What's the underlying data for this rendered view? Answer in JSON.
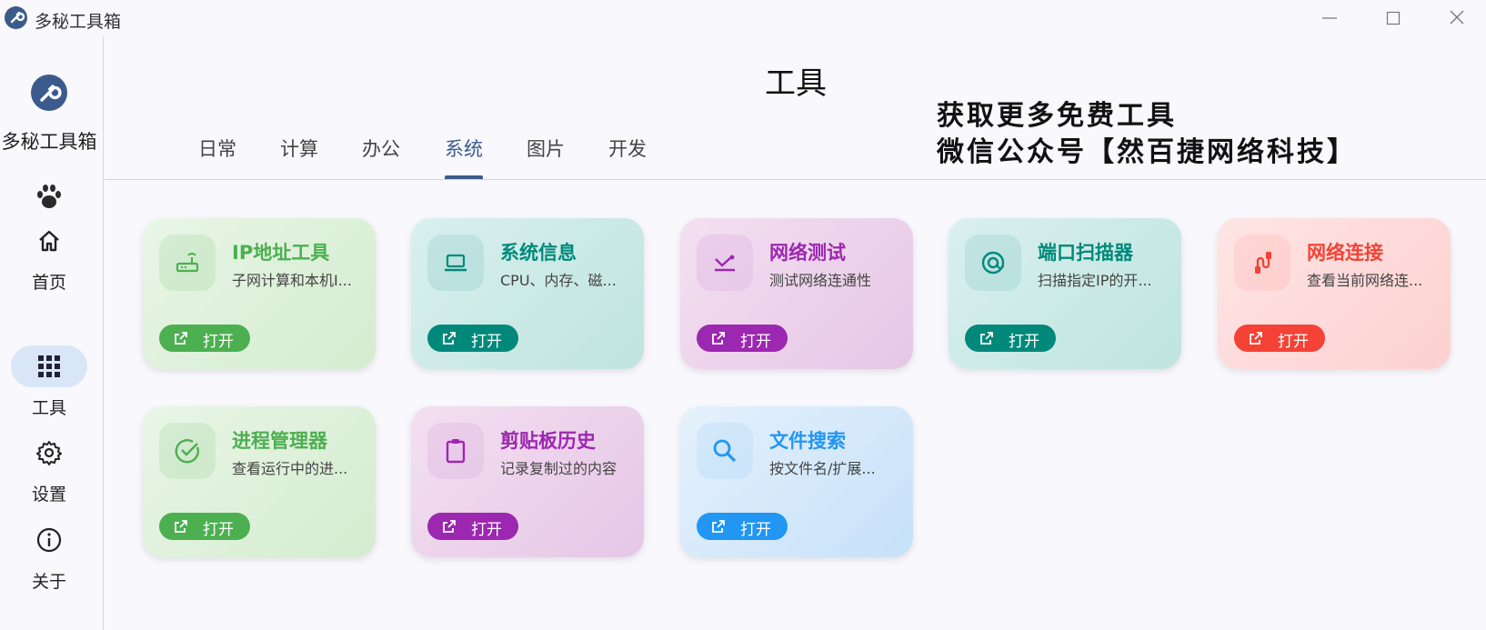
{
  "window": {
    "title": "多秘工具箱",
    "controls": [
      "minimize",
      "maximize",
      "close"
    ]
  },
  "sidebar": {
    "app_name": "多秘工具箱",
    "items": [
      {
        "label": "首页",
        "icon": "home-icon"
      },
      {
        "label": "工具",
        "icon": "grid-icon",
        "active": true
      },
      {
        "label": "设置",
        "icon": "gear-icon"
      },
      {
        "label": "关于",
        "icon": "info-icon"
      }
    ]
  },
  "header": {
    "title": "工具",
    "promo_line1": "获取更多免费工具",
    "promo_line2": "微信公众号【然百捷网络科技】"
  },
  "tabs": [
    {
      "label": "日常"
    },
    {
      "label": "计算"
    },
    {
      "label": "办公"
    },
    {
      "label": "系统",
      "active": true
    },
    {
      "label": "图片"
    },
    {
      "label": "开发"
    }
  ],
  "colors": {
    "accent": "#3b5b8c",
    "green": "#4caf50",
    "teal": "#00897b",
    "purple": "#9c27b0",
    "red": "#f44336",
    "blue": "#2196f3"
  },
  "cards": [
    {
      "title": "IP地址工具",
      "desc": "子网计算和本机I...",
      "button": "打开",
      "icon": "router-icon",
      "color": "#4caf50"
    },
    {
      "title": "系统信息",
      "desc": "CPU、内存、磁...",
      "button": "打开",
      "icon": "laptop-icon",
      "color": "#00897b"
    },
    {
      "title": "网络测试",
      "desc": "测试网络连通性",
      "button": "打开",
      "icon": "network-check-icon",
      "color": "#9c27b0"
    },
    {
      "title": "端口扫描器",
      "desc": "扫描指定IP的开...",
      "button": "打开",
      "icon": "at-sign-icon",
      "color": "#00897b"
    },
    {
      "title": "网络连接",
      "desc": "查看当前网络连...",
      "button": "打开",
      "icon": "cable-icon",
      "color": "#f44336"
    },
    {
      "title": "进程管理器",
      "desc": "查看运行中的进...",
      "button": "打开",
      "icon": "check-circle-icon",
      "color": "#4caf50"
    },
    {
      "title": "剪贴板历史",
      "desc": "记录复制过的内容",
      "button": "打开",
      "icon": "clipboard-icon",
      "color": "#9c27b0"
    },
    {
      "title": "文件搜索",
      "desc": "按文件名/扩展...",
      "button": "打开",
      "icon": "search-icon",
      "color": "#2196f3"
    }
  ]
}
